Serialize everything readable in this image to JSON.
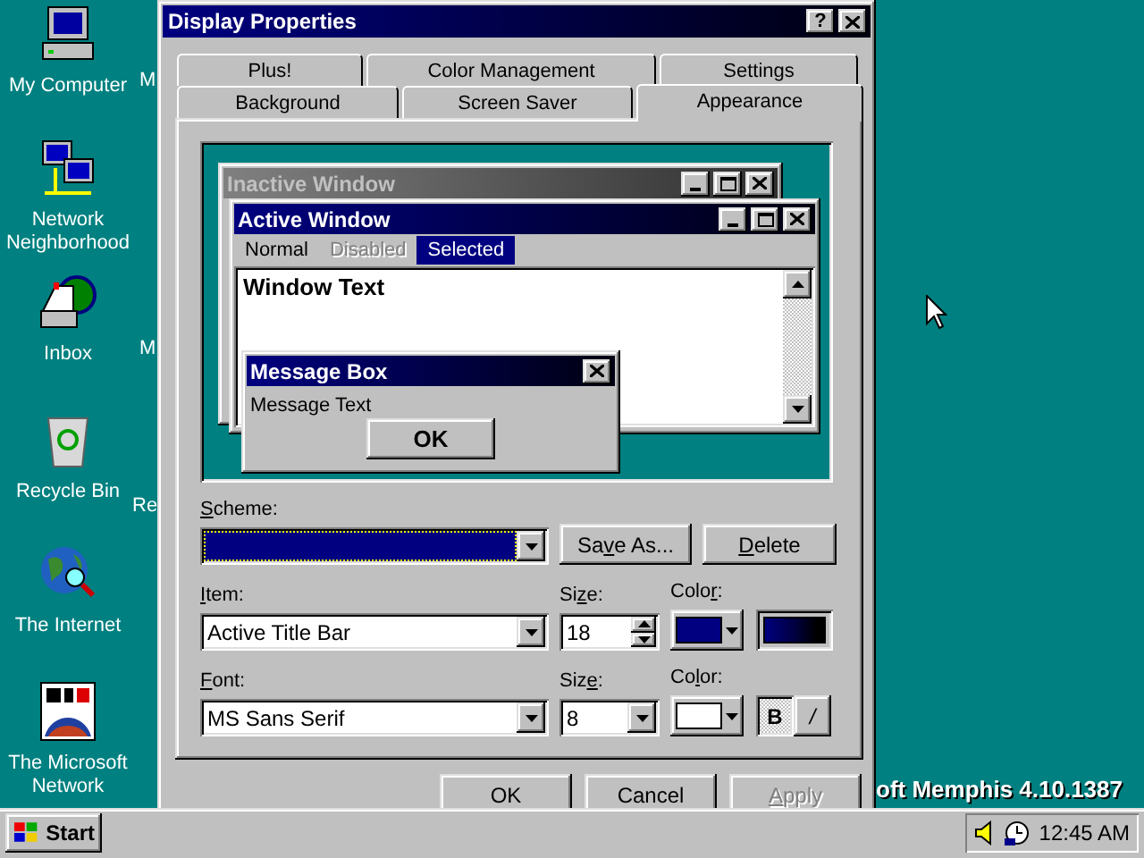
{
  "desktop": {
    "icons": [
      {
        "kind": "computer",
        "label": "My Computer"
      },
      {
        "kind": "network",
        "label": "Network Neighborhood"
      },
      {
        "kind": "inbox",
        "label": "Inbox"
      },
      {
        "kind": "recycle",
        "label": "Recycle Bin"
      },
      {
        "kind": "globe",
        "label": "The Internet"
      },
      {
        "kind": "msn",
        "label": "The Microsoft Network"
      }
    ],
    "hidden_labels": [
      "M",
      "M",
      "Re"
    ],
    "build_text": "oft Memphis 4.10.1387"
  },
  "dialog": {
    "title": "Display Properties",
    "help_button": "?",
    "tab_rows": [
      [
        {
          "label": "Plus!",
          "selected": false
        },
        {
          "label": "Color Management",
          "selected": false
        },
        {
          "label": "Settings",
          "selected": false
        }
      ],
      [
        {
          "label": "Background",
          "selected": false
        },
        {
          "label": "Screen Saver",
          "selected": false
        },
        {
          "label": "Appearance",
          "selected": true
        }
      ]
    ],
    "preview": {
      "inactive_title": "Inactive Window",
      "active_title": "Active Window",
      "menu": [
        {
          "label": "Normal",
          "disabled": false,
          "selected": false
        },
        {
          "label": "Disabled",
          "disabled": true,
          "selected": false
        },
        {
          "label": "Selected",
          "disabled": false,
          "selected": true
        }
      ],
      "window_text": "Window Text",
      "message_box": {
        "title": "Message Box",
        "text": "Message Text",
        "button": "OK"
      }
    },
    "scheme": {
      "label": {
        "key": "S",
        "post": "cheme:"
      },
      "highlighted": true
    },
    "save_as": {
      "pre": "Sa",
      "key": "v",
      "post": "e As..."
    },
    "delete": {
      "key": "D",
      "post": "elete"
    },
    "item": {
      "label": {
        "key": "I",
        "post": "tem:"
      },
      "value": "Active Title Bar",
      "size_label": {
        "pre": "Si",
        "key": "z",
        "post": "e:"
      },
      "size": "18",
      "color_label": {
        "pre": "Colo",
        "key": "r",
        "post": ":"
      },
      "color": "#000080",
      "color_2": {
        "color": "#000000"
      }
    },
    "font": {
      "label": {
        "key": "F",
        "post": "ont:"
      },
      "value": "MS Sans Serif",
      "size_label": {
        "pre": "Siz",
        "key": "e",
        "post": ":"
      },
      "size": "8",
      "color_label": {
        "pre": "Co",
        "key": "l",
        "post": "or:"
      },
      "color": "#ffffff",
      "bold_label": "B",
      "bold": true,
      "italic_label": "/",
      "italic": false
    },
    "buttons": [
      {
        "label": "OK",
        "disabled": false
      },
      {
        "label": "Cancel",
        "disabled": false
      },
      {
        "label": {
          "key": "A",
          "post": "pply"
        },
        "disabled": true
      }
    ]
  },
  "taskbar": {
    "start": "Start",
    "clock": "12:45 AM"
  }
}
